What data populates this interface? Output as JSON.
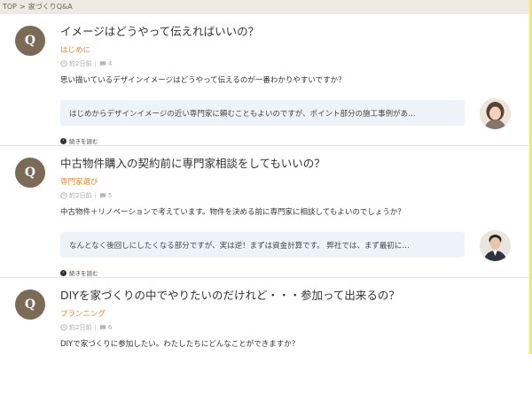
{
  "breadcrumb": {
    "home": "TOP",
    "separator": ">",
    "current": "家づくりQ&A"
  },
  "colors": {
    "accent": "#e58a2b",
    "badge": "#7b6a56",
    "answer_bg": "#eef3fa",
    "frame": "#f3ea5d"
  },
  "questions": [
    {
      "badge": "Q",
      "title": "イメージはどうやって伝えればいいの？",
      "category": "はじめに",
      "date": "約2日前",
      "comments": "4",
      "body": "思い描いているデザインイメージはどうやって伝えるのが一番わかりやすいですか？",
      "answer": "はじめからデザインイメージの近い専門家に頼むこともよいのですが、ポイント部分の施工事例があ…",
      "avatar": "female-expert-avatar",
      "read_more": "続きを読む"
    },
    {
      "badge": "Q",
      "title": "中古物件購入の契約前に専門家相談をしてもいいの？",
      "category": "専門家選び",
      "date": "約2日前",
      "comments": "5",
      "body": "中古物件＋リノベーションで考えています。物件を決める前に専門家に相談してもよいのでしょうか？",
      "answer": "なんとなく後回しにしたくなる部分ですが、実は逆！まずは資金計算です。 弊社では、まず最初に…",
      "avatar": "male-expert-avatar",
      "read_more": "続きを読む"
    },
    {
      "badge": "Q",
      "title": "DIYを家づくりの中でやりたいのだけれど・・・参加って出来るの？",
      "category": "プランニング",
      "date": "約2日前",
      "comments": "6",
      "body": "DIYで家づくりに参加したい。わたしたちにどんなことができますか？"
    }
  ]
}
